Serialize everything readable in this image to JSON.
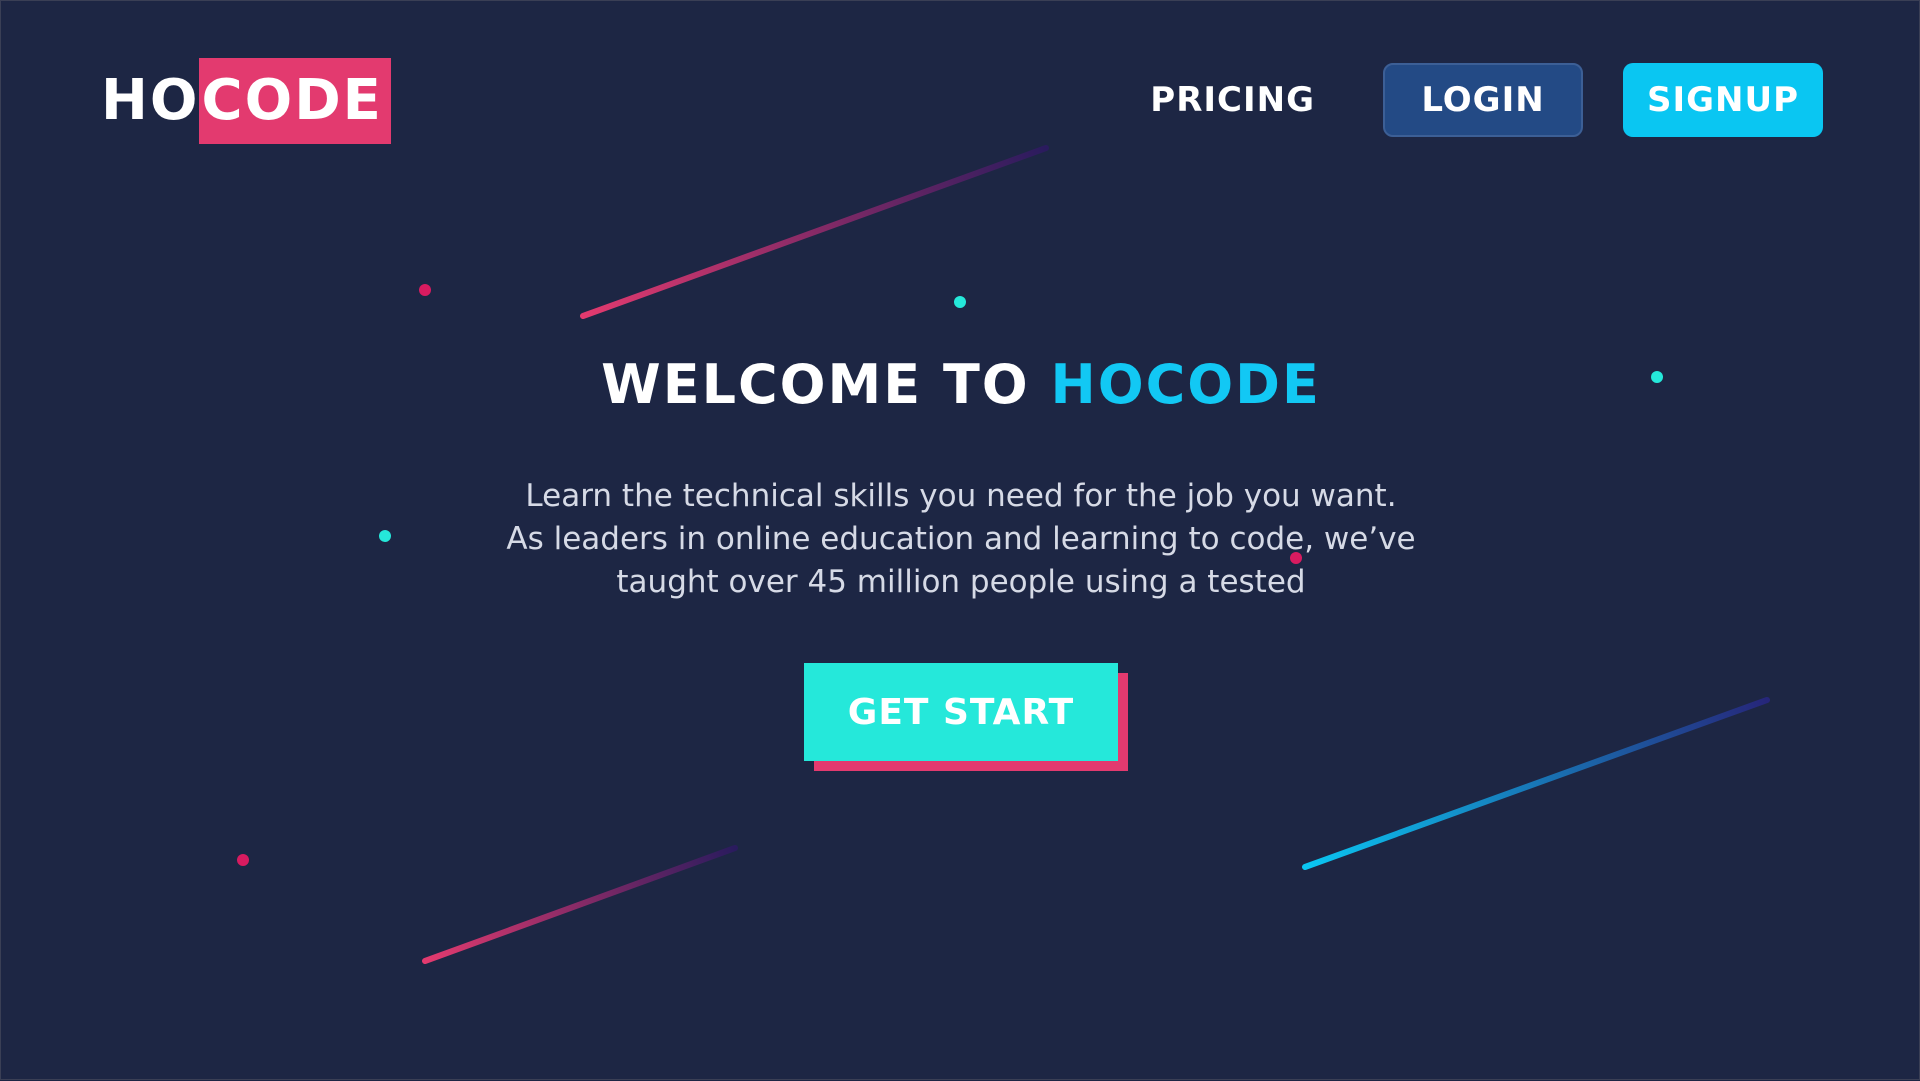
{
  "header": {
    "logo": {
      "part_a": "HO",
      "part_b": "CODE"
    },
    "nav": {
      "pricing_label": "PRICING",
      "login_label": "LOGIN",
      "signup_label": "SIGNUP"
    }
  },
  "hero": {
    "title_prefix": "WELCOME TO ",
    "title_brand": "HOCODE",
    "description_lines": [
      "Learn the technical skills you need for the job you want.",
      "As leaders in online education and learning to code, we’ve",
      "taught over 45 million people using a tested"
    ],
    "cta_label": "GET START"
  },
  "colors": {
    "background": "#1d2644",
    "accent_pink": "#e33a6f",
    "accent_cyan": "#12c8f4",
    "accent_teal": "#25e8da",
    "login_button": "#234a85",
    "signup_button": "#0ac6f2",
    "text_primary": "#ffffff",
    "text_muted": "#d6dae6"
  }
}
